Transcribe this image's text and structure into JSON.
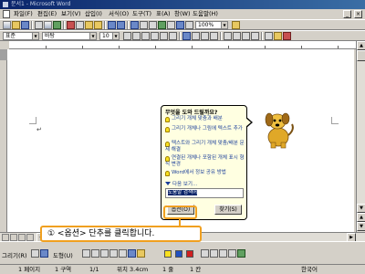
{
  "window": {
    "title": "문서1 - Microsoft Word"
  },
  "menu": {
    "items": [
      "파일(F)",
      "편집(E)",
      "보기(V)",
      "삽입(I)",
      "서식(O)",
      "도구(T)",
      "표(A)",
      "창(W)",
      "도움말(H)"
    ]
  },
  "toolbar": {
    "zoom": "100%",
    "style": "표준",
    "font": "바탕",
    "size": "10"
  },
  "assistant": {
    "question": "무엇을 도와 드릴까요?",
    "options": [
      "그리기 개체 맞춤과 배분",
      "그리기 개체나 그림에 텍스트 추가",
      "텍스트와 그리기 개체 맞춤/배분 문제 해결",
      "연결된 개체나 포함된 개체 표시 형식 변경",
      "Word에서 정보 공유 방법"
    ],
    "more": "다음 보기...",
    "input_value": "도움말 검색어",
    "options_button": "옵션(O)",
    "search_button": "찾기(S)",
    "colors": {
      "balloon": "#ffffe1",
      "link": "#1a3e9a"
    }
  },
  "callout": {
    "text": "① <옵션> 단추를 클릭합니다.",
    "color": "#f0a020"
  },
  "drawing": {
    "label": "그리기(R)",
    "autoshapes": "도형(U)"
  },
  "status": {
    "page": "1 페이지",
    "section": "1 구역",
    "pages": "1/1",
    "position": "위치 3.4cm",
    "line": "1 줄",
    "column": "1 칸",
    "language": "한국어"
  }
}
